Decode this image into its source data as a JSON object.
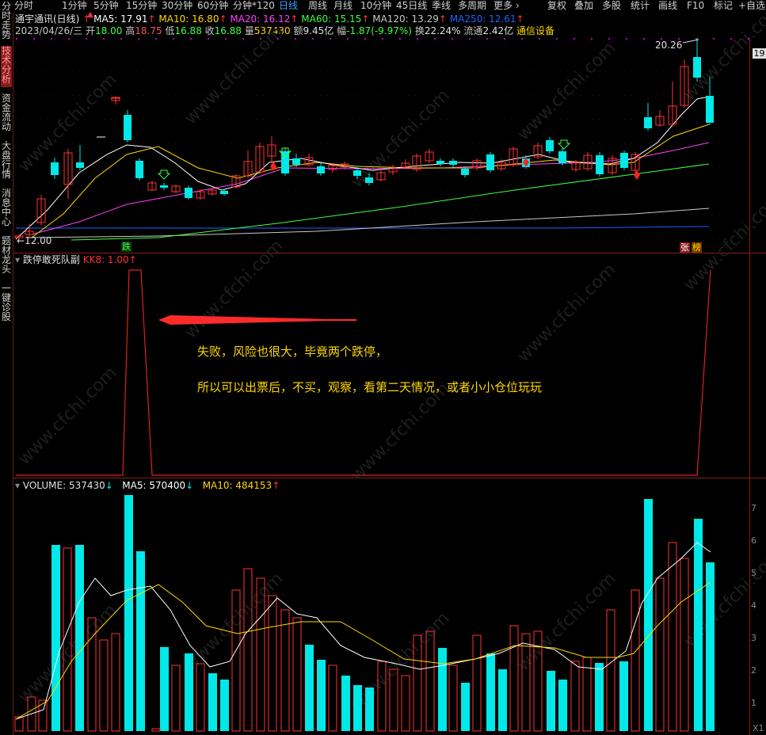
{
  "toolbar": {
    "periods": [
      "分时",
      "1分钟",
      "5分钟",
      "15分钟",
      "30分钟",
      "60分钟",
      "分钟*120",
      "日线",
      "周线",
      "月线",
      "10分钟",
      "45日线",
      "季线",
      "多周期",
      "更多 ›"
    ],
    "active_period": "日线",
    "right_buttons": [
      "复权",
      "叠加",
      "多股",
      "统计",
      "画线",
      "F10",
      "标记",
      "+自选"
    ]
  },
  "sidebar": {
    "items": [
      {
        "label": "分时走势"
      },
      {
        "label": "技术分析"
      },
      {
        "label": "资金流动"
      },
      {
        "label": "大盘行情"
      },
      {
        "label": "消息中心"
      },
      {
        "label": "题材龙头"
      },
      {
        "label": "一键诊股"
      }
    ]
  },
  "stock": {
    "name": "通宇通讯(日线)",
    "ma": [
      {
        "label": "MA5: 17.91",
        "color": "#ffffff"
      },
      {
        "label": "MA10: 16.80",
        "color": "#ffd800"
      },
      {
        "label": "MA20: 16.12",
        "color": "#ff40ff"
      },
      {
        "label": "MA60: 15.15",
        "color": "#40ff40"
      },
      {
        "label": "MA120: 13.29",
        "color": "#c8c8c8"
      },
      {
        "label": "MA250: 12.61",
        "color": "#2060ff"
      }
    ],
    "date": "2023/04/26/三",
    "open_label": "开",
    "open": "18.00",
    "high_label": "高",
    "high": "18.75",
    "low_label": "低",
    "low": "16.88",
    "close_label": "收",
    "close": "16.88",
    "volume_label": "量",
    "volume": "537430",
    "amount_label": "额",
    "amount": "9.45亿",
    "change_label": "幅",
    "change": "-1.87(-9.97%)",
    "turnover_label": "换",
    "turnover": "22.24%",
    "float_label": "流通",
    "float": "2.42亿",
    "sector": "通信设备",
    "high_marker": "20.26",
    "low_marker": "←12.00",
    "right_price": "19",
    "tag_die": "跌",
    "tag_zhang": "张",
    "tag_bang": "榜"
  },
  "indicator": {
    "name": "跌停敢死队副",
    "value_label": "KK8: 1.00"
  },
  "annotation": {
    "line1": "失败，风险也很大，毕竟两个跌停，",
    "line2": "所以可以出票后，不买，观察，看第二天情况，或者小小仓位玩玩"
  },
  "volume_pane": {
    "volume_label": "VOLUME: 537430",
    "ma5_label": "MA5: 570400",
    "ma10_label": "MA10: 484153",
    "axis": [
      "7",
      "6",
      "5",
      "4",
      "3",
      "2",
      "1"
    ],
    "unit": "X1"
  },
  "colors": {
    "up": "#ff3232",
    "down": "#00e8e8",
    "border": "#8b1a1a",
    "annotation": "#ffd800",
    "active_tab": "#3aa0ff"
  },
  "watermark": "www.cfchi.com"
}
